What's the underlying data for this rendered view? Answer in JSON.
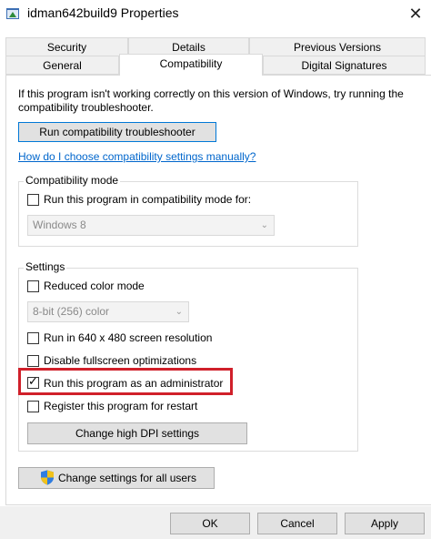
{
  "window": {
    "title": "idman642build9 Properties",
    "close_glyph": "✕"
  },
  "tabs": {
    "row1": [
      "Security",
      "Details",
      "Previous Versions"
    ],
    "row2": [
      "General",
      "Compatibility",
      "Digital Signatures"
    ],
    "active": "Compatibility"
  },
  "intro_text": "If this program isn't working correctly on this version of Windows, try running the compatibility troubleshooter.",
  "buttons": {
    "troubleshooter": "Run compatibility troubleshooter",
    "change_dpi": "Change high DPI settings",
    "change_all_users": "Change settings for all users",
    "ok": "OK",
    "cancel": "Cancel",
    "apply": "Apply"
  },
  "help_link": "How do I choose compatibility settings manually?",
  "compat_mode": {
    "label": "Compatibility mode",
    "checkbox": {
      "label": "Run this program in compatibility mode for:",
      "checked": false
    },
    "select_value": "Windows 8"
  },
  "settings": {
    "label": "Settings",
    "reduced_color": {
      "label": "Reduced color mode",
      "checked": false
    },
    "color_select_value": "8-bit (256) color",
    "res_640": {
      "label": "Run in 640 x 480 screen resolution",
      "checked": false
    },
    "disable_fullscreen": {
      "label": "Disable fullscreen optimizations",
      "checked": false
    },
    "run_as_admin": {
      "label": "Run this program as an administrator",
      "checked": true
    },
    "register_restart": {
      "label": "Register this program for restart",
      "checked": false
    }
  },
  "colors": {
    "highlight": "#d0202a",
    "link": "#0066cc",
    "focus_border": "#0078d7"
  },
  "icons": {
    "app": "app-window-icon",
    "shield": "uac-shield-icon",
    "check": "✓",
    "dropdown": "⌄"
  }
}
